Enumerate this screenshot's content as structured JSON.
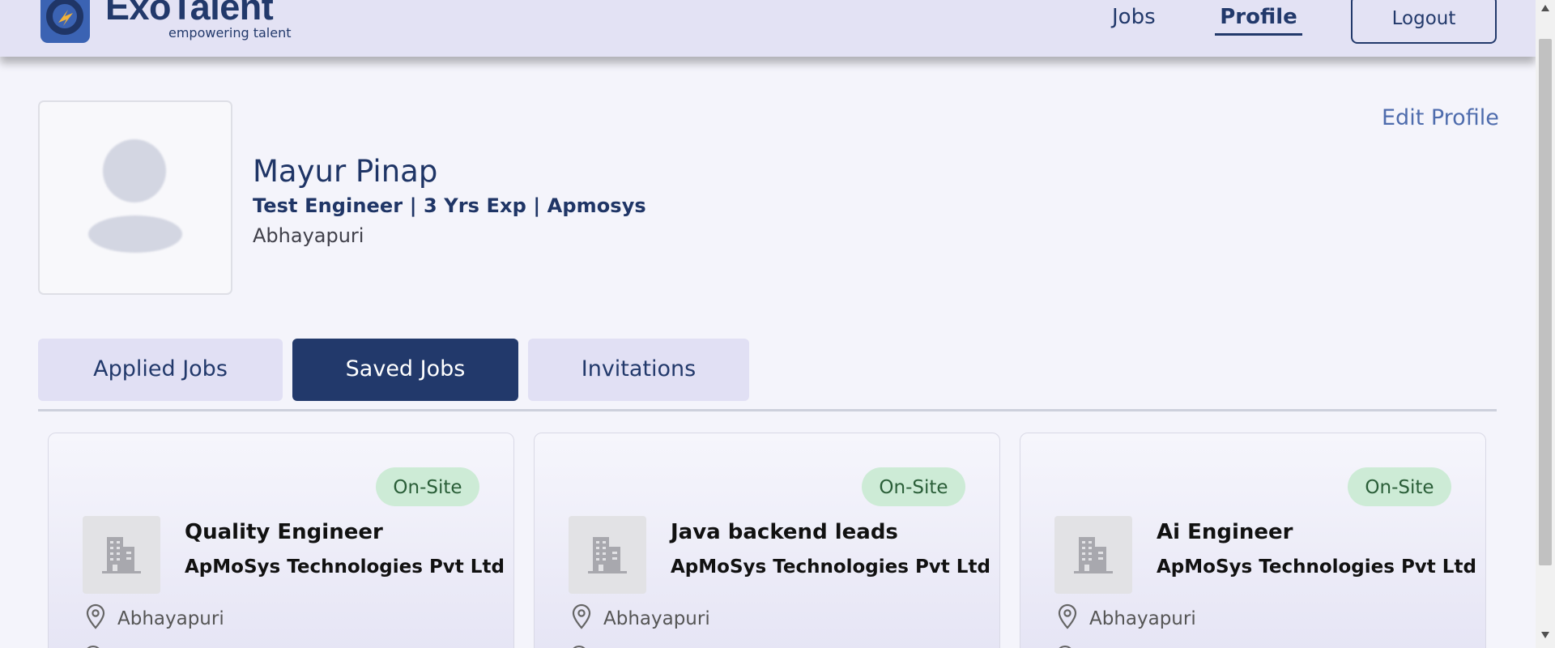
{
  "header": {
    "logo_name": "ExoTalent",
    "logo_tagline": "empowering talent",
    "nav": {
      "jobs_label": "Jobs",
      "profile_label": "Profile"
    },
    "logout_label": "Logout"
  },
  "profile": {
    "name": "Mayur Pinap",
    "headline": "Test Engineer | 3 Yrs Exp | Apmosys",
    "location": "Abhayapuri",
    "edit_label": "Edit Profile"
  },
  "tabs": [
    {
      "label": "Applied Jobs",
      "active": false
    },
    {
      "label": "Saved Jobs",
      "active": true
    },
    {
      "label": "Invitations",
      "active": false
    }
  ],
  "jobs": [
    {
      "badge": "On-Site",
      "title": "Quality Engineer",
      "company": "ApMoSys Technologies Pvt Ltd",
      "location": "Abhayapuri"
    },
    {
      "badge": "On-Site",
      "title": "Java backend leads",
      "company": "ApMoSys Technologies Pvt Ltd",
      "location": "Abhayapuri"
    },
    {
      "badge": "On-Site",
      "title": "Ai Engineer",
      "company": "ApMoSys Technologies Pvt Ltd",
      "location": "Abhayapuri"
    }
  ],
  "icons": {
    "logo": "exotalent-logo-icon",
    "avatar": "user-avatar-icon",
    "company": "building-icon",
    "location": "map-pin-icon"
  },
  "colors": {
    "primary": "#22396b",
    "header_bg": "#e3e2f4",
    "tab_bg": "#e1e0f4",
    "badge_bg": "#cdebd6",
    "badge_text": "#2a5e38",
    "link": "#4e6cad"
  }
}
